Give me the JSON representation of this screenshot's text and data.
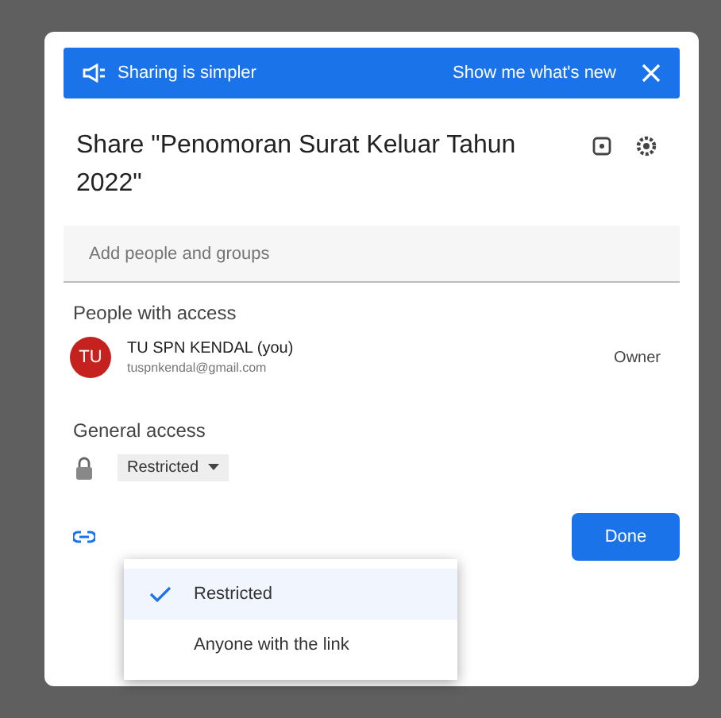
{
  "banner": {
    "message": "Sharing is simpler",
    "action": "Show me what's new"
  },
  "title": "Share \"Penomoran Surat Keluar Tahun 2022\"",
  "add_field": {
    "placeholder": "Add people and groups"
  },
  "people_section": {
    "heading": "People with access",
    "people": [
      {
        "initials": "TU",
        "name": "TU SPN KENDAL (you)",
        "email": "tuspnkendal@gmail.com",
        "role": "Owner",
        "color": "#c5221f"
      }
    ]
  },
  "general_access": {
    "heading": "General access",
    "value": "Restricted",
    "menu": [
      {
        "label": "Restricted",
        "selected": true
      },
      {
        "label": "Anyone with the link",
        "selected": false
      }
    ]
  },
  "buttons": {
    "done": "Done"
  }
}
